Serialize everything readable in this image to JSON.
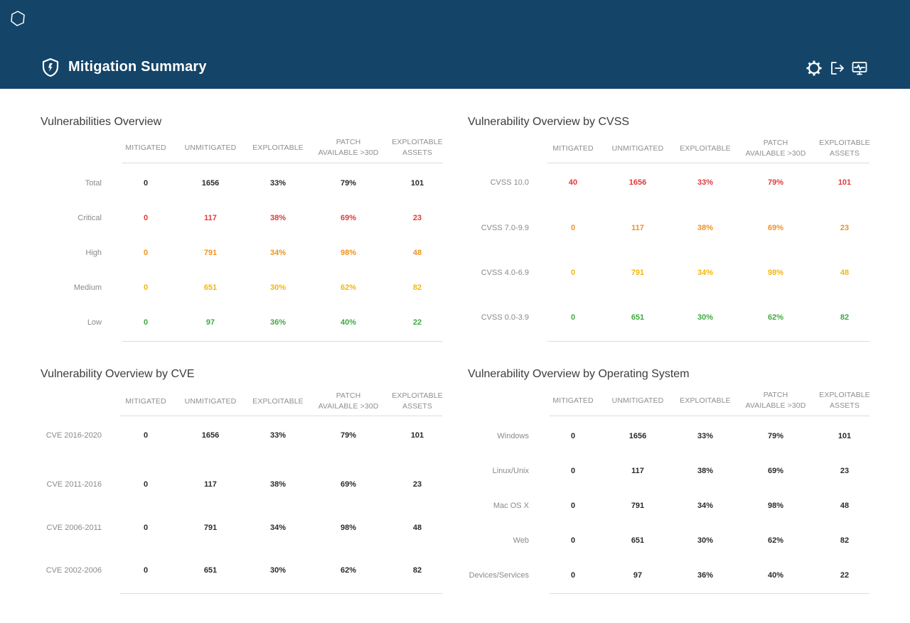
{
  "header": {
    "title": "Mitigation Summary",
    "icons": {
      "logo": "hexagon-logo-icon",
      "title": "shield-icon",
      "settings": "gear-icon",
      "logout": "logout-icon",
      "monitor": "monitor-icon"
    },
    "background": "#144468"
  },
  "colors": {
    "dark": "#2b2b2b",
    "red": "#e03a3a",
    "orange": "#f0921e",
    "yellow": "#f3b60e",
    "green": "#43a843"
  },
  "columns": {
    "mitigated": "MITIGATED",
    "unmitigated": "UNMITIGATED",
    "exploitable": "EXPLOITABLE",
    "patch_line1": "PATCH",
    "patch_line2": "AVAILABLE >30D",
    "assets_line1": "EXPLOITABLE",
    "assets_line2": "ASSETS"
  },
  "panels": {
    "overview": {
      "title": "Vulnerabilities Overview",
      "rows": [
        {
          "label": "Total",
          "color": "dark",
          "values": [
            "0",
            "1656",
            "33%",
            "79%",
            "101"
          ]
        },
        {
          "label": "Critical",
          "color": "red",
          "values": [
            "0",
            "117",
            "38%",
            "69%",
            "23"
          ]
        },
        {
          "label": "High",
          "color": "orange",
          "values": [
            "0",
            "791",
            "34%",
            "98%",
            "48"
          ]
        },
        {
          "label": "Medium",
          "color": "yellow",
          "values": [
            "0",
            "651",
            "30%",
            "62%",
            "82"
          ]
        },
        {
          "label": "Low",
          "color": "green",
          "values": [
            "0",
            "97",
            "36%",
            "40%",
            "22"
          ]
        }
      ]
    },
    "cvss": {
      "title": "Vulnerability Overview by CVSS",
      "rows": [
        {
          "label": "CVSS 10.0",
          "color": "red",
          "values": [
            "40",
            "1656",
            "33%",
            "79%",
            "101"
          ]
        },
        {
          "label": "CVSS 7.0-9.9",
          "color": "orange",
          "values": [
            "0",
            "117",
            "38%",
            "69%",
            "23"
          ]
        },
        {
          "label": "CVSS 4.0-6.9",
          "color": "yellow",
          "values": [
            "0",
            "791",
            "34%",
            "98%",
            "48"
          ]
        },
        {
          "label": "CVSS 0.0-3.9",
          "color": "green",
          "values": [
            "0",
            "651",
            "30%",
            "62%",
            "82"
          ]
        }
      ]
    },
    "cve": {
      "title": "Vulnerability Overview by CVE",
      "rows": [
        {
          "label": "CVE 2016-2020",
          "color": "dark",
          "values": [
            "0",
            "1656",
            "33%",
            "79%",
            "101"
          ]
        },
        {
          "label": "CVE 2011-2016",
          "color": "dark",
          "values": [
            "0",
            "117",
            "38%",
            "69%",
            "23"
          ]
        },
        {
          "label": "CVE 2006-2011",
          "color": "dark",
          "values": [
            "0",
            "791",
            "34%",
            "98%",
            "48"
          ]
        },
        {
          "label": "CVE 2002-2006",
          "color": "dark",
          "values": [
            "0",
            "651",
            "30%",
            "62%",
            "82"
          ]
        }
      ]
    },
    "os": {
      "title": "Vulnerability Overview by Operating System",
      "rows": [
        {
          "label": "Windows",
          "color": "dark",
          "values": [
            "0",
            "1656",
            "33%",
            "79%",
            "101"
          ]
        },
        {
          "label": "Linux/Unix",
          "color": "dark",
          "values": [
            "0",
            "117",
            "38%",
            "69%",
            "23"
          ]
        },
        {
          "label": "Mac OS X",
          "color": "dark",
          "values": [
            "0",
            "791",
            "34%",
            "98%",
            "48"
          ]
        },
        {
          "label": "Web",
          "color": "dark",
          "values": [
            "0",
            "651",
            "30%",
            "62%",
            "82"
          ]
        },
        {
          "label": "Devices/Services",
          "color": "dark",
          "values": [
            "0",
            "97",
            "36%",
            "40%",
            "22"
          ]
        }
      ]
    }
  }
}
